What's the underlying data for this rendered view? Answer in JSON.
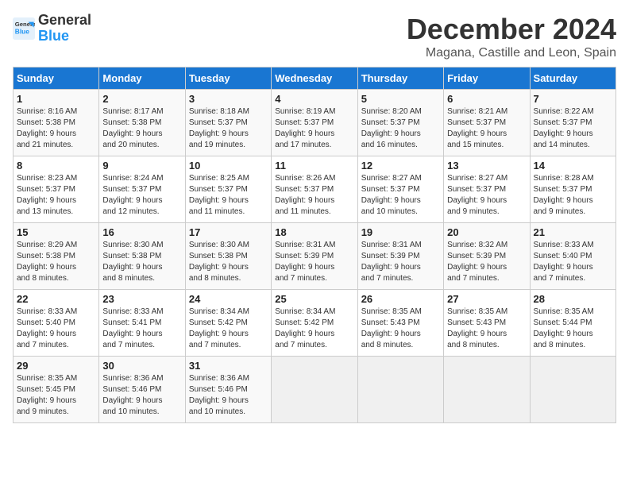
{
  "logo": {
    "line1": "General",
    "line2": "Blue"
  },
  "title": "December 2024",
  "location": "Magana, Castille and Leon, Spain",
  "days_header": [
    "Sunday",
    "Monday",
    "Tuesday",
    "Wednesday",
    "Thursday",
    "Friday",
    "Saturday"
  ],
  "weeks": [
    [
      {
        "day": "1",
        "text": "Sunrise: 8:16 AM\nSunset: 5:38 PM\nDaylight: 9 hours\nand 21 minutes."
      },
      {
        "day": "2",
        "text": "Sunrise: 8:17 AM\nSunset: 5:38 PM\nDaylight: 9 hours\nand 20 minutes."
      },
      {
        "day": "3",
        "text": "Sunrise: 8:18 AM\nSunset: 5:37 PM\nDaylight: 9 hours\nand 19 minutes."
      },
      {
        "day": "4",
        "text": "Sunrise: 8:19 AM\nSunset: 5:37 PM\nDaylight: 9 hours\nand 17 minutes."
      },
      {
        "day": "5",
        "text": "Sunrise: 8:20 AM\nSunset: 5:37 PM\nDaylight: 9 hours\nand 16 minutes."
      },
      {
        "day": "6",
        "text": "Sunrise: 8:21 AM\nSunset: 5:37 PM\nDaylight: 9 hours\nand 15 minutes."
      },
      {
        "day": "7",
        "text": "Sunrise: 8:22 AM\nSunset: 5:37 PM\nDaylight: 9 hours\nand 14 minutes."
      }
    ],
    [
      {
        "day": "8",
        "text": "Sunrise: 8:23 AM\nSunset: 5:37 PM\nDaylight: 9 hours\nand 13 minutes."
      },
      {
        "day": "9",
        "text": "Sunrise: 8:24 AM\nSunset: 5:37 PM\nDaylight: 9 hours\nand 12 minutes."
      },
      {
        "day": "10",
        "text": "Sunrise: 8:25 AM\nSunset: 5:37 PM\nDaylight: 9 hours\nand 11 minutes."
      },
      {
        "day": "11",
        "text": "Sunrise: 8:26 AM\nSunset: 5:37 PM\nDaylight: 9 hours\nand 11 minutes."
      },
      {
        "day": "12",
        "text": "Sunrise: 8:27 AM\nSunset: 5:37 PM\nDaylight: 9 hours\nand 10 minutes."
      },
      {
        "day": "13",
        "text": "Sunrise: 8:27 AM\nSunset: 5:37 PM\nDaylight: 9 hours\nand 9 minutes."
      },
      {
        "day": "14",
        "text": "Sunrise: 8:28 AM\nSunset: 5:37 PM\nDaylight: 9 hours\nand 9 minutes."
      }
    ],
    [
      {
        "day": "15",
        "text": "Sunrise: 8:29 AM\nSunset: 5:38 PM\nDaylight: 9 hours\nand 8 minutes."
      },
      {
        "day": "16",
        "text": "Sunrise: 8:30 AM\nSunset: 5:38 PM\nDaylight: 9 hours\nand 8 minutes."
      },
      {
        "day": "17",
        "text": "Sunrise: 8:30 AM\nSunset: 5:38 PM\nDaylight: 9 hours\nand 8 minutes."
      },
      {
        "day": "18",
        "text": "Sunrise: 8:31 AM\nSunset: 5:39 PM\nDaylight: 9 hours\nand 7 minutes."
      },
      {
        "day": "19",
        "text": "Sunrise: 8:31 AM\nSunset: 5:39 PM\nDaylight: 9 hours\nand 7 minutes."
      },
      {
        "day": "20",
        "text": "Sunrise: 8:32 AM\nSunset: 5:39 PM\nDaylight: 9 hours\nand 7 minutes."
      },
      {
        "day": "21",
        "text": "Sunrise: 8:33 AM\nSunset: 5:40 PM\nDaylight: 9 hours\nand 7 minutes."
      }
    ],
    [
      {
        "day": "22",
        "text": "Sunrise: 8:33 AM\nSunset: 5:40 PM\nDaylight: 9 hours\nand 7 minutes."
      },
      {
        "day": "23",
        "text": "Sunrise: 8:33 AM\nSunset: 5:41 PM\nDaylight: 9 hours\nand 7 minutes."
      },
      {
        "day": "24",
        "text": "Sunrise: 8:34 AM\nSunset: 5:42 PM\nDaylight: 9 hours\nand 7 minutes."
      },
      {
        "day": "25",
        "text": "Sunrise: 8:34 AM\nSunset: 5:42 PM\nDaylight: 9 hours\nand 7 minutes."
      },
      {
        "day": "26",
        "text": "Sunrise: 8:35 AM\nSunset: 5:43 PM\nDaylight: 9 hours\nand 8 minutes."
      },
      {
        "day": "27",
        "text": "Sunrise: 8:35 AM\nSunset: 5:43 PM\nDaylight: 9 hours\nand 8 minutes."
      },
      {
        "day": "28",
        "text": "Sunrise: 8:35 AM\nSunset: 5:44 PM\nDaylight: 9 hours\nand 8 minutes."
      }
    ],
    [
      {
        "day": "29",
        "text": "Sunrise: 8:35 AM\nSunset: 5:45 PM\nDaylight: 9 hours\nand 9 minutes."
      },
      {
        "day": "30",
        "text": "Sunrise: 8:36 AM\nSunset: 5:46 PM\nDaylight: 9 hours\nand 10 minutes."
      },
      {
        "day": "31",
        "text": "Sunrise: 8:36 AM\nSunset: 5:46 PM\nDaylight: 9 hours\nand 10 minutes."
      },
      {
        "day": "",
        "text": ""
      },
      {
        "day": "",
        "text": ""
      },
      {
        "day": "",
        "text": ""
      },
      {
        "day": "",
        "text": ""
      }
    ]
  ]
}
